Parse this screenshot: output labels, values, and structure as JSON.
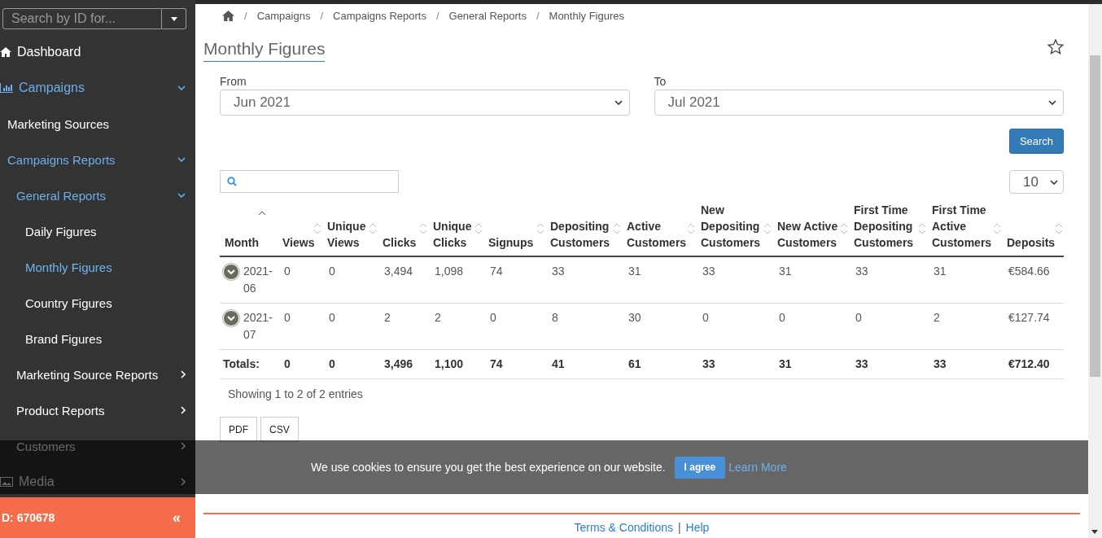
{
  "sidebar": {
    "search": {
      "placeholder": "Search by ID for..."
    },
    "items": [
      {
        "label": "Dashboard",
        "selected": false
      },
      {
        "label": "Campaigns",
        "expanded": true,
        "children": [
          {
            "label": "Marketing Sources",
            "selected": false
          },
          {
            "label": "Campaigns Reports",
            "expanded": true,
            "children": [
              {
                "label": "General Reports",
                "expanded": true,
                "children": [
                  {
                    "label": "Daily Figures",
                    "selected": false
                  },
                  {
                    "label": "Monthly Figures",
                    "selected": true
                  },
                  {
                    "label": "Country Figures",
                    "selected": false
                  },
                  {
                    "label": "Brand Figures",
                    "selected": false
                  }
                ]
              },
              {
                "label": "Marketing Source Reports",
                "expanded": false
              },
              {
                "label": "Product Reports",
                "expanded": false
              },
              {
                "label": "Customers",
                "expanded": false
              }
            ]
          }
        ]
      },
      {
        "label": "Media",
        "expanded": false
      }
    ],
    "account": "D: 670678",
    "collapse": "«"
  },
  "breadcrumb": [
    {
      "separator": "/",
      "label": "Campaigns"
    },
    {
      "separator": "/",
      "label": "Campaigns Reports"
    },
    {
      "separator": "/",
      "label": "General Reports"
    },
    {
      "separator": "/",
      "label": "Monthly Figures"
    }
  ],
  "title": "Monthly Figures",
  "filters": [
    {
      "label": "From",
      "value": "Jun 2021"
    },
    {
      "label": "To",
      "value": "Jul 2021"
    }
  ],
  "search_button": "Search",
  "page_length": "10",
  "table": {
    "columns": [
      {
        "label": "Month",
        "sorted": true
      },
      {
        "label": "Views",
        "sorted": false
      },
      {
        "label": "Unique Views",
        "sorted": false
      },
      {
        "label": "Clicks",
        "sorted": false
      },
      {
        "label": "Unique Clicks",
        "sorted": false
      },
      {
        "label": "Signups",
        "sorted": false
      },
      {
        "label": "Depositing Customers",
        "sorted": false
      },
      {
        "label": "Active Customers",
        "sorted": false
      },
      {
        "label": "New Depositing Customers",
        "sorted": false
      },
      {
        "label": "New Active Customers",
        "sorted": false
      },
      {
        "label": "First Time Depositing Customers",
        "sorted": false
      },
      {
        "label": "First Time Active Customers",
        "sorted": false
      },
      {
        "label": "Deposits",
        "sorted": false
      }
    ],
    "rows": [
      [
        "2021-06",
        "0",
        "0",
        "3,494",
        "1,098",
        "74",
        "33",
        "31",
        "33",
        "31",
        "33",
        "31",
        "€584.66"
      ],
      [
        "2021-07",
        "0",
        "0",
        "2",
        "2",
        "0",
        "8",
        "30",
        "0",
        "0",
        "0",
        "2",
        "€127.74"
      ]
    ],
    "totals": [
      "Totals:",
      "0",
      "0",
      "3,496",
      "1,100",
      "74",
      "41",
      "61",
      "33",
      "31",
      "33",
      "33",
      "€712.40"
    ]
  },
  "info": "Showing 1 to 2 of 2 entries",
  "export_buttons": [
    "PDF",
    "CSV"
  ],
  "cookie_banner": {
    "text": "We use cookies to ensure you get the best experience on our website.",
    "accept": "I agree",
    "link": "Learn More"
  },
  "footer": {
    "links": [
      "Terms & Conditions",
      "Help"
    ],
    "separator": "|"
  }
}
